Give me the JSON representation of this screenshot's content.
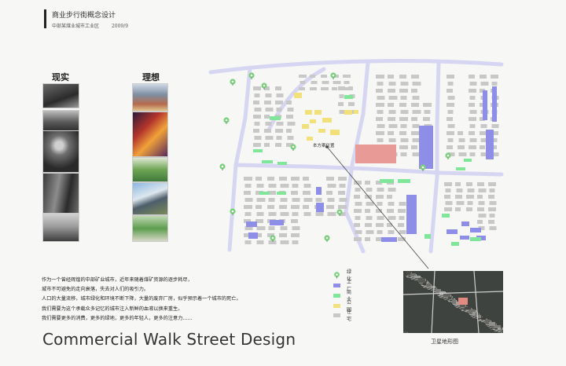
{
  "header": {
    "title": "商业步行街概念设计",
    "subtitle": "中部某煤业城市工业区",
    "date": "2009/9"
  },
  "columns": {
    "reality": "现实",
    "ideal": "理想"
  },
  "body_text": [
    "作为一个曾经辉煌的中部矿业城市，近年来随着煤矿资源的逐步耗尽，",
    "城市不可避免的走向衰落，失去对人们的吸引力。",
    "人口的大量流移，城市绿化和环境不断下降，大量的废弃厂房，似乎预示着一个城市的死亡。",
    "我们需要为这个承载众多记忆的城市注入新鲜的血液以换来重生。",
    "我们需要更多的消费，更多的绿地，更多的年轻人，更多的注意力……"
  ],
  "big_title": "Commercial Walk Street Design",
  "map": {
    "site_label": "本方案位置"
  },
  "legend": [
    {
      "label": "绿化",
      "kind": "tree",
      "color": "#7bd07b"
    },
    {
      "label": "工厂",
      "kind": "swatch",
      "color": "#8e8ee8"
    },
    {
      "label": "商业",
      "kind": "swatch",
      "color": "#7fe69a"
    },
    {
      "label": "公园",
      "kind": "swatch",
      "color": "#f2e07a"
    },
    {
      "label": "住宅",
      "kind": "swatch",
      "color": "#c8c8c8"
    }
  ],
  "satellite_caption": "卫星地形图",
  "colors": {
    "road": "#d6d6f2",
    "residential": "#c8c8c8",
    "factory": "#8e8ee8",
    "commercial": "#7fe69a",
    "park": "#f2e07a",
    "site": "#e89a96",
    "tree": "#7bd07b"
  }
}
